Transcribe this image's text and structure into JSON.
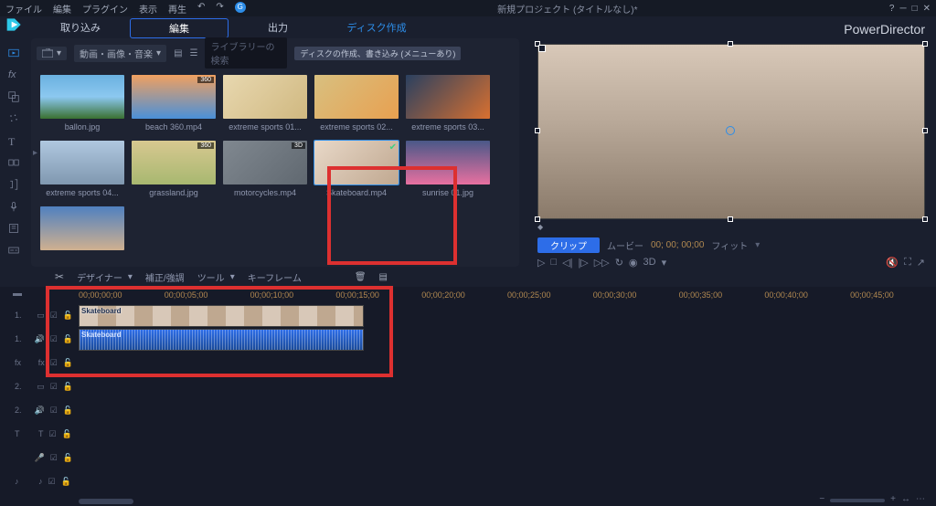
{
  "titlebar": {
    "menus": [
      "ファイル",
      "編集",
      "プラグイン",
      "表示",
      "再生"
    ],
    "project": "新規プロジェクト (タイトルなし)*",
    "help_icon": "?"
  },
  "brand": "PowerDirector",
  "tabs": {
    "capture": "取り込み",
    "edit": "編集",
    "output": "出力",
    "disc": "ディスク作成"
  },
  "library": {
    "dropdown": "動画・画像・音楽",
    "search_placeholder": "ライブラリーの検索",
    "disc_note": "ディスクの作成、書き込み (メニューあり)",
    "items": [
      {
        "label": "ballon.jpg",
        "cls": "balloon",
        "badge": ""
      },
      {
        "label": "beach 360.mp4",
        "cls": "beach",
        "badge": "360"
      },
      {
        "label": "extreme sports 01...",
        "cls": "sport1",
        "badge": ""
      },
      {
        "label": "extreme sports 02...",
        "cls": "sport2",
        "badge": ""
      },
      {
        "label": "extreme sports 03...",
        "cls": "sport3",
        "badge": ""
      },
      {
        "label": "extreme sports 04...",
        "cls": "sport4",
        "badge": ""
      },
      {
        "label": "grassland.jpg",
        "cls": "grass",
        "badge": "360"
      },
      {
        "label": "motorcycles.mp4",
        "cls": "moto",
        "badge": "3D"
      },
      {
        "label": "Skateboard.mp4",
        "cls": "skate",
        "badge": "",
        "selected": true
      },
      {
        "label": "sunrise 01.jpg",
        "cls": "sunrise",
        "badge": ""
      },
      {
        "label": "",
        "cls": "sky",
        "badge": ""
      }
    ]
  },
  "preview": {
    "clip_btn": "クリップ",
    "movie_btn": "ムービー",
    "timecode": "00; 00; 00;00",
    "fit": "フィット",
    "threeD": "3D"
  },
  "toolbar": {
    "designer": "デザイナー",
    "fix": "補正/強調",
    "tool": "ツール",
    "keyframe": "キーフレーム"
  },
  "timeline": {
    "marks": [
      "00;00;00;00",
      "00;00;05;00",
      "00;00;10;00",
      "00;00;15;00",
      "00;00;20;00",
      "00;00;25;00",
      "00;00;30;00",
      "00;00;35;00",
      "00;00;40;00",
      "00;00;45;00"
    ],
    "tracks": [
      {
        "n": "1.",
        "ico": "video"
      },
      {
        "n": "1.",
        "ico": "audio"
      },
      {
        "n": "fx",
        "ico": "fx"
      },
      {
        "n": "2.",
        "ico": "video"
      },
      {
        "n": "2.",
        "ico": "audio"
      },
      {
        "n": "T",
        "ico": "title"
      },
      {
        "n": "",
        "ico": "voice"
      },
      {
        "n": "♪",
        "ico": "music"
      }
    ],
    "clip_name_v": "Skateboard",
    "clip_name_a": "Skateboard"
  }
}
